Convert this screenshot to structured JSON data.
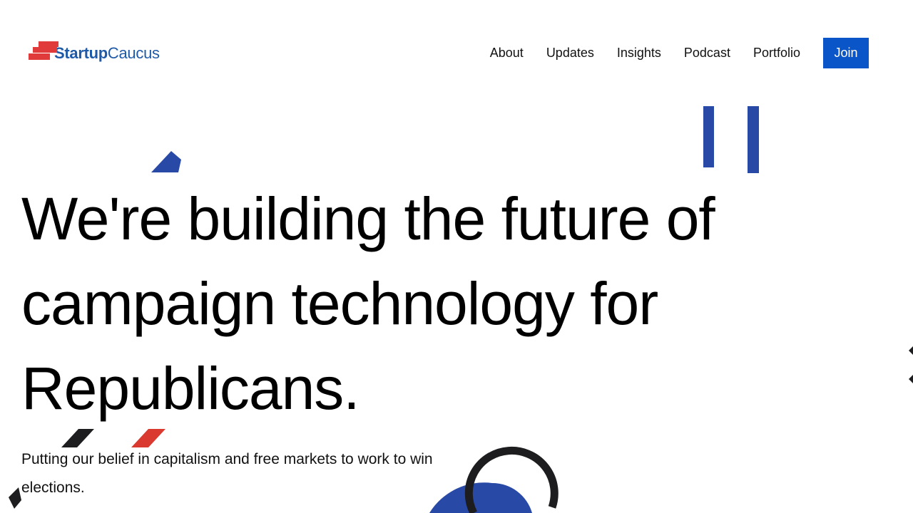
{
  "header": {
    "logo": {
      "bold_text": "Startup",
      "light_text": "Caucus",
      "colors": {
        "red": "#e03a3a",
        "blue": "#1e5aa8"
      }
    },
    "nav": {
      "items": [
        {
          "label": "About"
        },
        {
          "label": "Updates"
        },
        {
          "label": "Insights"
        },
        {
          "label": "Podcast"
        },
        {
          "label": "Portfolio"
        }
      ],
      "join_label": "Join"
    }
  },
  "hero": {
    "title": "We're building the future of campaign technology for Republicans.",
    "subtitle": "Putting our belief in capitalism and free markets to work to win elections."
  },
  "colors": {
    "accent_blue": "#2849a6",
    "button_blue": "#0a55c7",
    "accent_red": "#d9392e",
    "dark": "#1d1d1f"
  }
}
